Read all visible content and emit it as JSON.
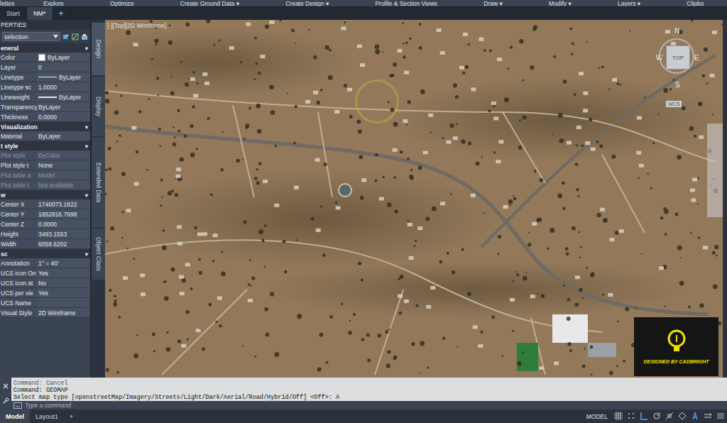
{
  "ribbon": {
    "tabs": [
      "lettes",
      "Explore",
      "Optimize",
      "Create Ground Data ▾",
      "Create Design ▾",
      "Profile & Section Views",
      "Draw ▾",
      "Modify ▾",
      "Layers ▾",
      "Clipbo"
    ]
  },
  "doc_tabs": [
    {
      "label": "Start",
      "selected": false
    },
    {
      "label": "NM*",
      "selected": true
    }
  ],
  "new_tab": "+",
  "properties": {
    "title": "PERTIES",
    "selector": "selection",
    "sections": [
      {
        "title": "eneral",
        "toggle": "▾",
        "rows": [
          {
            "label": "Color",
            "value": "ByLayer",
            "kind": "color",
            "disabled": false
          },
          {
            "label": "Layer",
            "value": "0",
            "kind": "text",
            "disabled": false
          },
          {
            "label": "Linetype",
            "value": "ByLayer",
            "kind": "line",
            "disabled": false
          },
          {
            "label": "Linetype sc",
            "value": "1.0000",
            "kind": "text",
            "disabled": false
          },
          {
            "label": "Lineweight",
            "value": "ByLayer",
            "kind": "line",
            "disabled": false
          },
          {
            "label": "Transparency",
            "value": "ByLayer",
            "kind": "text",
            "disabled": false
          },
          {
            "label": "Thickness",
            "value": "0.0000",
            "kind": "text",
            "disabled": false
          }
        ]
      },
      {
        "title": " Visualization",
        "toggle": "▾",
        "rows": [
          {
            "label": "Material",
            "value": "ByLayer",
            "kind": "text",
            "disabled": false
          }
        ]
      },
      {
        "title": "t style",
        "toggle": "▾",
        "rows": [
          {
            "label": "Plot style",
            "value": "ByColor",
            "kind": "text",
            "disabled": true
          },
          {
            "label": "Plot style t",
            "value": "None",
            "kind": "text",
            "disabled": false
          },
          {
            "label": "Plot table a",
            "value": "Model",
            "kind": "text",
            "disabled": true
          },
          {
            "label": "Plot table t",
            "value": "Not available",
            "kind": "text",
            "disabled": true
          }
        ]
      },
      {
        "title": "w",
        "toggle": "▾",
        "rows": [
          {
            "label": "Center X",
            "value": "1740073.1622",
            "kind": "text",
            "disabled": false
          },
          {
            "label": "Center Y",
            "value": "1652816.7698",
            "kind": "text",
            "disabled": false
          },
          {
            "label": "Center Z",
            "value": "0.0000",
            "kind": "text",
            "disabled": false
          },
          {
            "label": "Height",
            "value": "3493.1553",
            "kind": "text",
            "disabled": false
          },
          {
            "label": "Width",
            "value": "6058.6202",
            "kind": "text",
            "disabled": false
          }
        ]
      },
      {
        "title": "sc",
        "toggle": "▾",
        "rows": [
          {
            "label": "Annotation",
            "value": "1\" = 40'",
            "kind": "text",
            "disabled": false
          },
          {
            "label": "UCS icon On",
            "value": "Yes",
            "kind": "text",
            "disabled": false
          },
          {
            "label": "UCS icon at",
            "value": "No",
            "kind": "text",
            "disabled": false
          },
          {
            "label": "UCS per vie",
            "value": "Yes",
            "kind": "text",
            "disabled": false
          },
          {
            "label": "UCS Name",
            "value": "",
            "kind": "text",
            "disabled": false
          },
          {
            "label": "Visual Style",
            "value": "2D Wireframe",
            "kind": "text",
            "disabled": false
          }
        ]
      }
    ]
  },
  "side_tabs": [
    {
      "label": "Design",
      "selected": true
    },
    {
      "label": "Display",
      "selected": false
    },
    {
      "label": "Extended Data",
      "selected": false
    },
    {
      "label": "Object Class",
      "selected": false
    }
  ],
  "viewport": {
    "label": "[-][Top][2D Wireframe]",
    "viewcube": {
      "n": "N",
      "w": "W",
      "s": "S",
      "e": "E",
      "face": "TOP",
      "wcs": "WCS"
    },
    "badge": "DESIGNED BY CADBRIGHT"
  },
  "command": {
    "history": [
      "Command: Cancel",
      "Command: GEOMAP",
      "Select map type [openstreetMap/Imagery/Streets/Light/Dark/Aerial/Road/Hybrid/Off] <Off>: A"
    ],
    "placeholder": "Type a command"
  },
  "layout_tabs": [
    {
      "label": "Model",
      "selected": true
    },
    {
      "label": "Layout1",
      "selected": false
    }
  ],
  "new_layout": "+",
  "status_bar": {
    "mode": "MODEL"
  }
}
